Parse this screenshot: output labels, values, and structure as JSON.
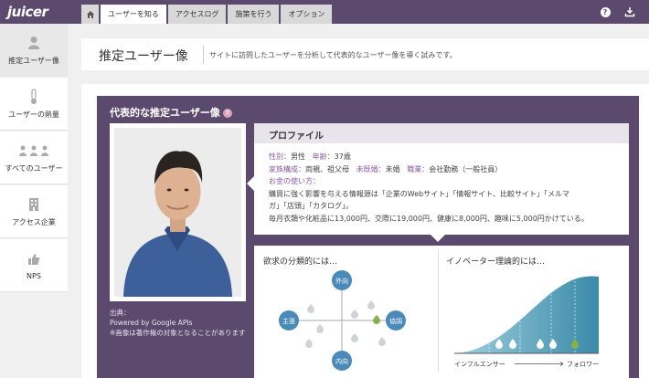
{
  "app": {
    "logo_text": "juicer"
  },
  "nav": {
    "tabs": [
      {
        "label": "ユーザーを知る",
        "active": true
      },
      {
        "label": "アクセスログ",
        "active": false
      },
      {
        "label": "施策を行う",
        "active": false
      },
      {
        "label": "オプション",
        "active": false
      }
    ]
  },
  "sidebar": {
    "items": [
      {
        "label": "推定ユーザー像",
        "icon": "person-icon",
        "active": true
      },
      {
        "label": "ユーザーの熱量",
        "icon": "thermometer-icon",
        "active": false
      },
      {
        "label": "すべてのユーザー",
        "icon": "group-icon",
        "active": false
      },
      {
        "label": "アクセス企業",
        "icon": "building-icon",
        "active": false
      },
      {
        "label": "NPS",
        "icon": "thumbs-up-icon",
        "active": false
      }
    ]
  },
  "header": {
    "title": "推定ユーザー像",
    "description": "サイトに訪問したユーザーを分析して代表的なユーザー像を導く試みです。"
  },
  "persona": {
    "title": "代表的な推定ユーザー像",
    "help": "?",
    "credit_line1": "出典：",
    "credit_line2": "Powered by Google APIs",
    "credit_line3": "※画像は著作権の対象となることがあります"
  },
  "profile": {
    "title": "プロファイル",
    "gender_label": "性別：",
    "gender": "男性",
    "age_label": "年齢：",
    "age": "37歳",
    "family_label": "家族構成：",
    "family": "両親、祖父母",
    "marital_label": "未既婚：",
    "marital": "未婚",
    "job_label": "職業：",
    "job": "会社勤務（一般社員）",
    "money_label": "お金の使い方：",
    "money_line1": "購買に強く影響を与える情報源は「企業のWebサイト」「情報サイト、比較サイト」「メルマ",
    "money_line2": "ガ」「店頭」「カタログ」。",
    "money_line3": "毎月衣類や化粧品に13,000円、交際に19,000円、健康に8,000円、趣味に5,000円かけている。"
  },
  "needs": {
    "title": "欲求の分類的には…",
    "top": "外向",
    "left": "主張",
    "right": "協調",
    "bottom": "内向"
  },
  "innovator": {
    "title": "イノベーター理論的には…",
    "left_label": "インフルエンサー",
    "right_label": "フォロワー"
  },
  "colors": {
    "topbar": "#5b4a6e",
    "persona_bg": "#5b4a6e",
    "accent": "#8a5aa0",
    "circle_blue": "#4a8ab8",
    "drop_green": "#8ab04a"
  }
}
